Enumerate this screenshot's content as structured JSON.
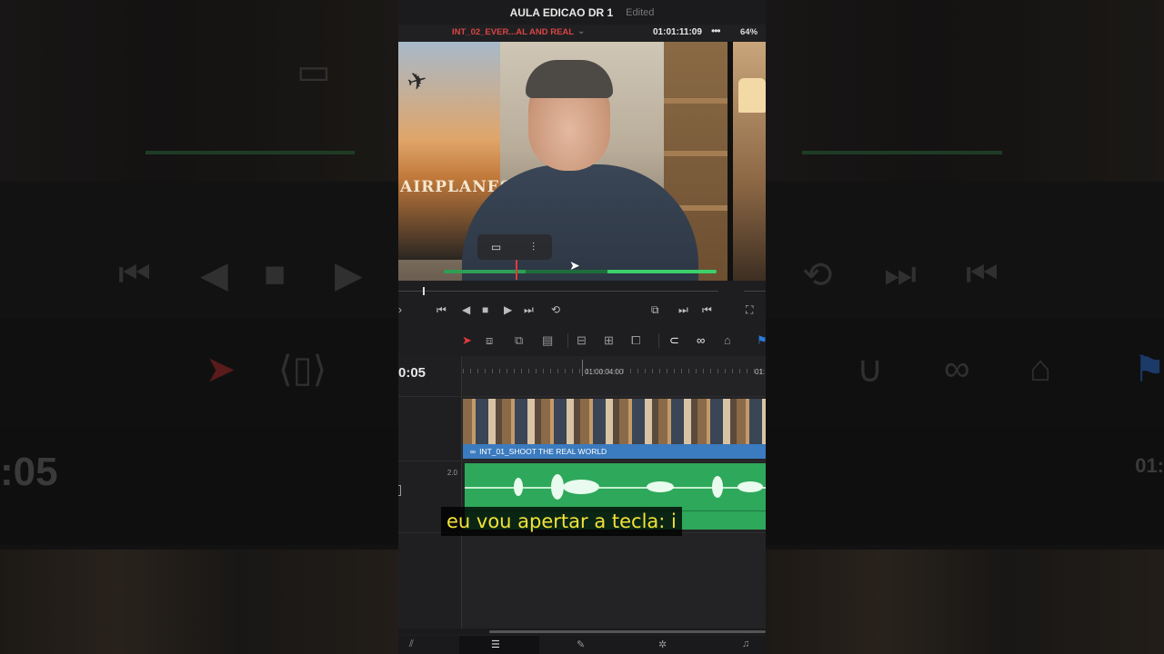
{
  "window": {
    "project_title": "AULA EDICAO DR 1",
    "status": "Edited"
  },
  "viewer_bar": {
    "clip_name": "INT_02_EVER...AL AND REAL",
    "timecode": "01:01:11:09",
    "zoom": "64%"
  },
  "timeline": {
    "current_timecode": "0:05",
    "ruler_label": "01:00:04:00",
    "ruler_label_partial": "01:",
    "audio_track_volume": "2.0",
    "video_clip_label": "INT_01_SHOOT THE REAL WORLD"
  },
  "poster": {
    "text": "AIRPLANES"
  },
  "subtitle": {
    "text": "eu vou apertar a tecla: i"
  },
  "side": {
    "left_timecode": ":05",
    "right_timecode": "01:"
  },
  "icons": {
    "accent_red": "#d94545",
    "audio_green": "#2ea85a",
    "clip_blue": "#3b7bbf"
  }
}
